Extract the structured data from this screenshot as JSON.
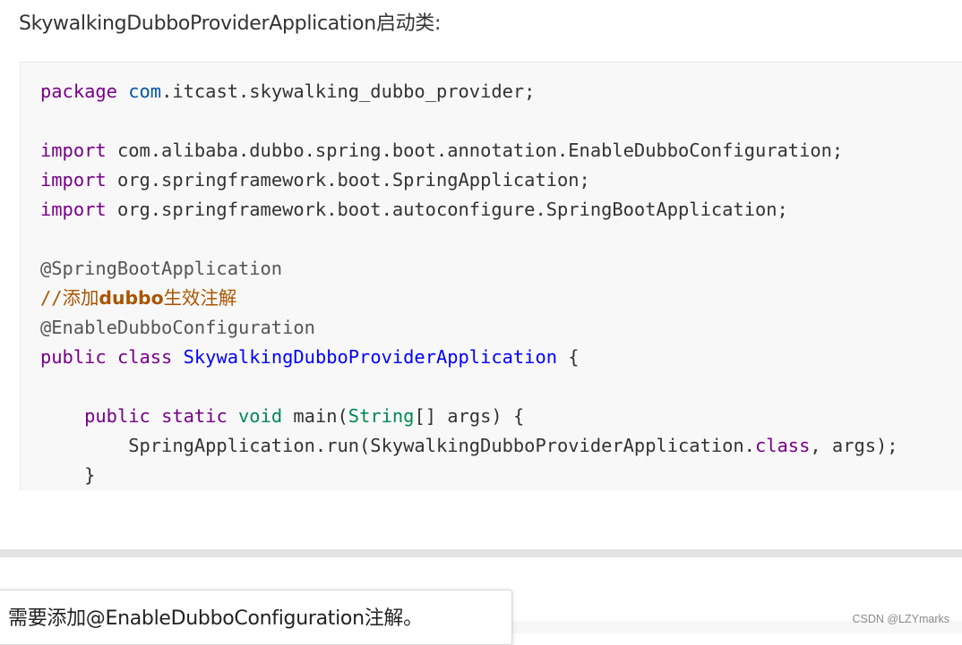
{
  "title": "SkywalkingDubboProviderApplication启动类:",
  "code": {
    "l1_pkg_kw": "package",
    "l1_com": "com",
    "l1_rest": ".itcast.skywalking_dubbo_provider;",
    "import_kw": "import",
    "imp1": " com.alibaba.dubbo.spring.boot.annotation.EnableDubboConfiguration;",
    "imp2": " org.springframework.boot.SpringApplication;",
    "imp3": " org.springframework.boot.autoconfigure.SpringBootApplication;",
    "ann1": "@SpringBootApplication",
    "comment_slashes": "//",
    "comment_pre": "添加",
    "comment_bold": "dubbo",
    "comment_post": "生效注解",
    "ann2": "@EnableDubboConfiguration",
    "public_kw": "public",
    "class_kw": "class",
    "class_name": "SkywalkingDubboProviderApplication",
    "open_brace": " {",
    "static_kw": "static",
    "void_kw": "void",
    "main_sig": " main(",
    "string_type": "String",
    "args_sig": "[] args) {",
    "run_call": "SpringApplication.run(SkywalkingDubboProviderApplication.",
    "class_ref": "class",
    "run_end": ", args);",
    "close_brace": "}"
  },
  "note": "需要添加@EnableDubboConfiguration注解。",
  "watermark": "CSDN @LZYmarks"
}
